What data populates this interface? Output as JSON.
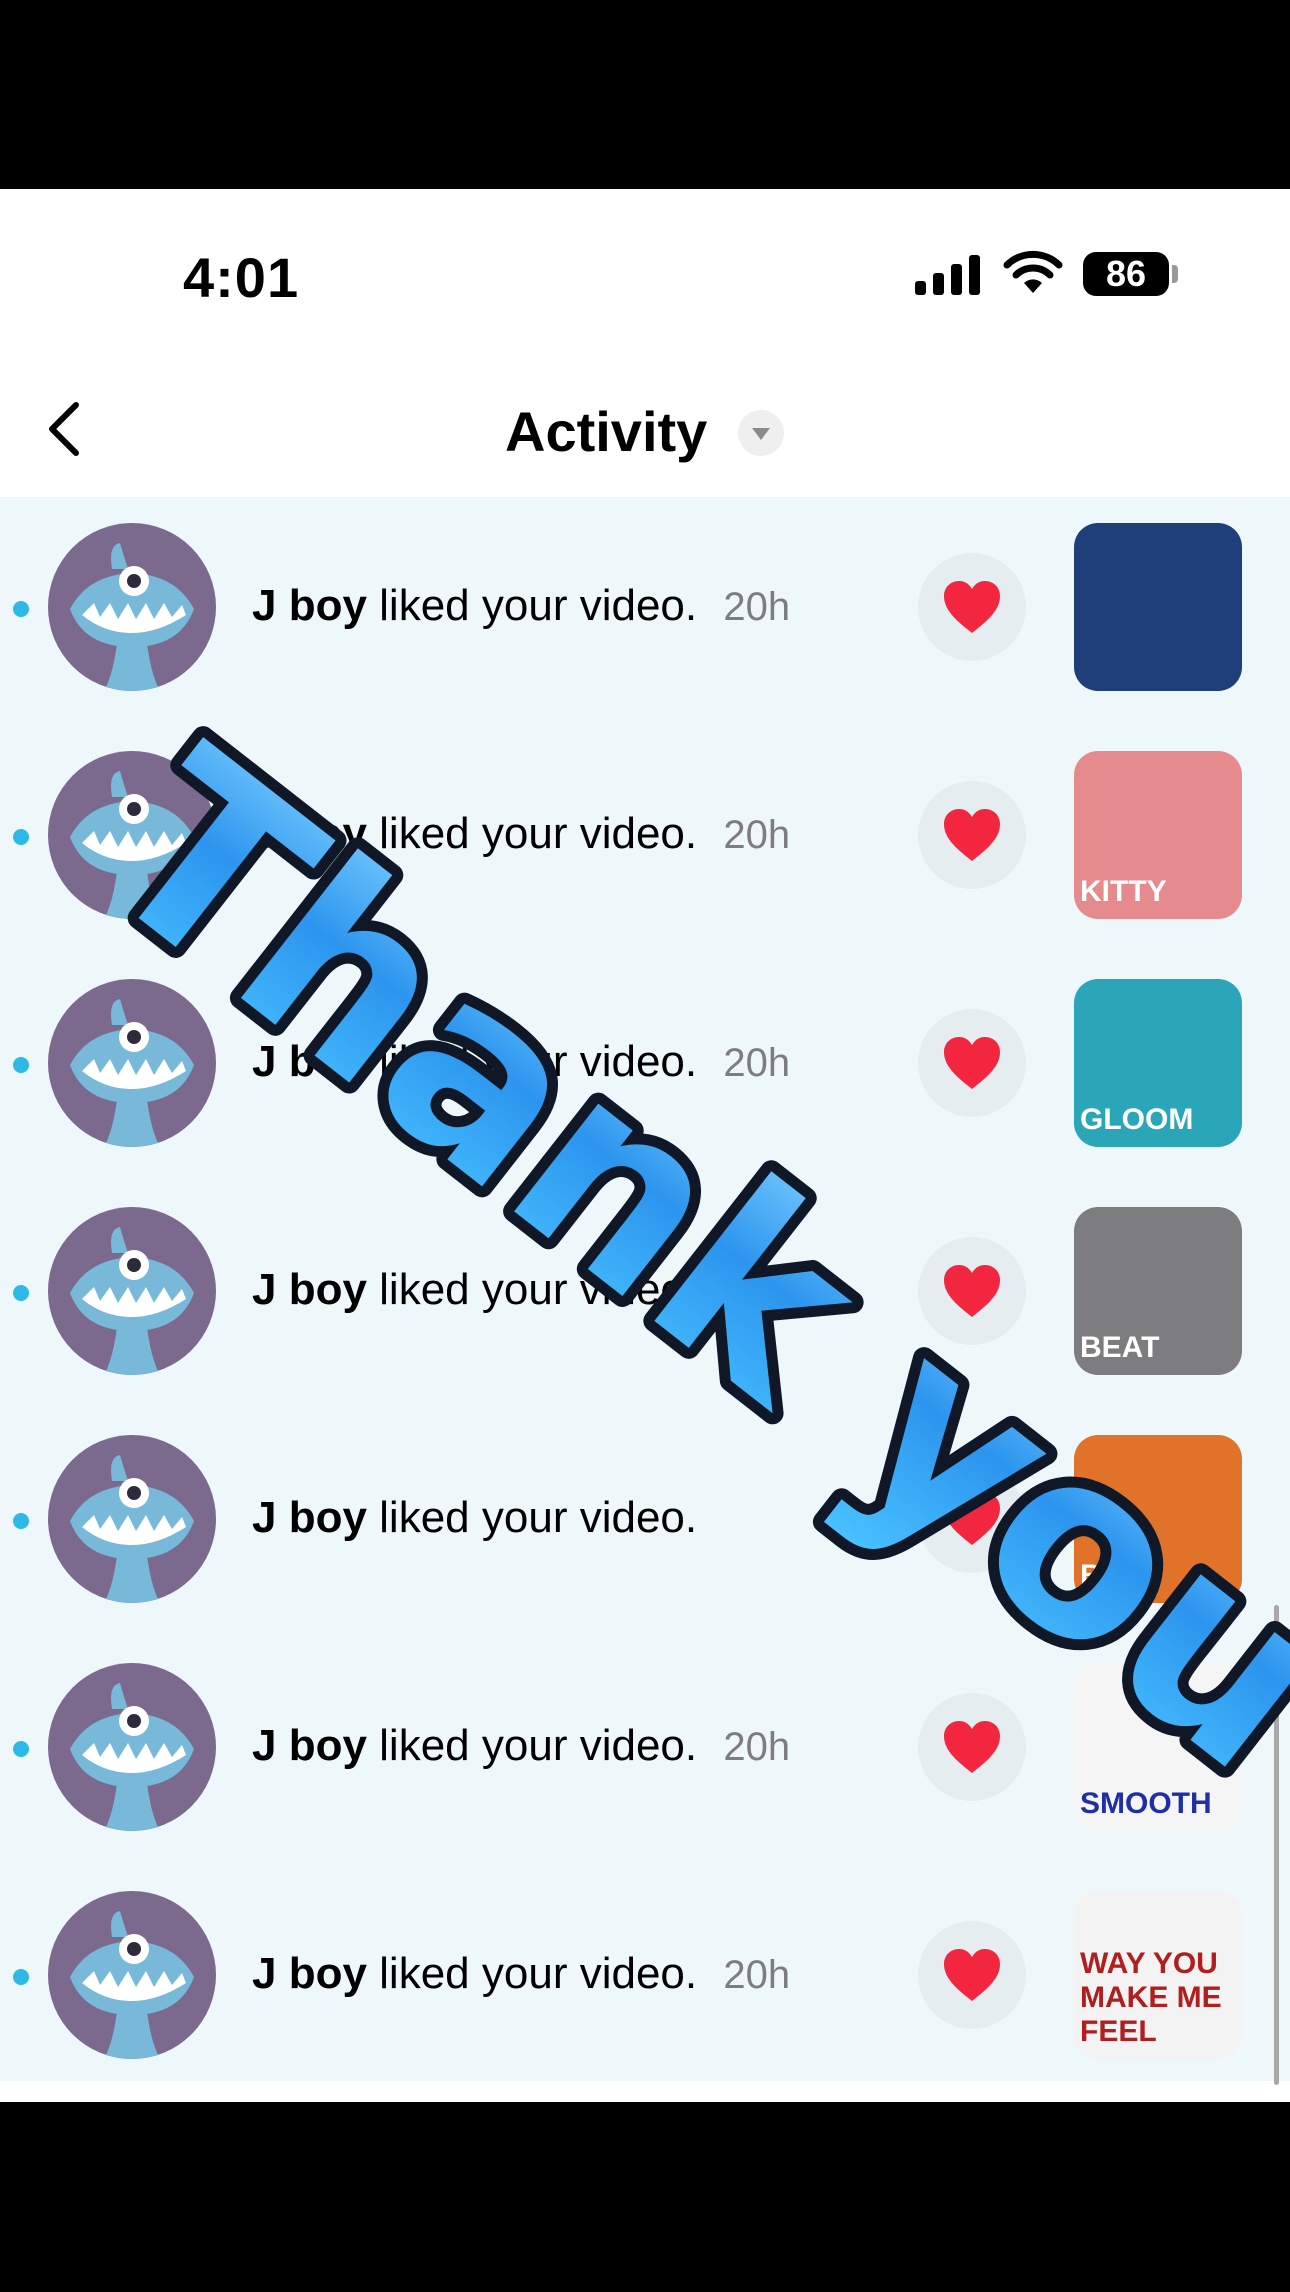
{
  "status_bar": {
    "time": "4:01",
    "battery": "86"
  },
  "header": {
    "title": "Activity"
  },
  "rows": [
    {
      "name": "J boy",
      "action": "liked your video.",
      "time": "20h",
      "thumb_bg": "#1f3f7a",
      "thumb_caption": ""
    },
    {
      "name": "J boy",
      "action": "liked your video.",
      "time": "20h",
      "thumb_bg": "#e58a8d",
      "thumb_caption": "KITTY"
    },
    {
      "name": "J boy",
      "action": "liked your video.",
      "time": "20h",
      "thumb_bg": "#2aa6b8",
      "thumb_caption": "GLOOM"
    },
    {
      "name": "J boy",
      "action": "liked your video.",
      "time": "20h",
      "thumb_bg": "#7d7d80",
      "thumb_caption": "BEAT"
    },
    {
      "name": "J boy",
      "action": "liked your video.",
      "time": "",
      "thumb_bg": "#e0722a",
      "thumb_caption": "Billie"
    },
    {
      "name": "J boy",
      "action": "liked your video.",
      "time": "20h",
      "thumb_bg": "#f5f5f5",
      "thumb_caption": "SMOOTH"
    },
    {
      "name": "J boy",
      "action": "liked your video.",
      "time": "20h",
      "thumb_bg": "#f3f3f3",
      "thumb_caption": "WAY YOU MAKE ME FEEL"
    }
  ],
  "overlay": {
    "text": "Thank you"
  },
  "colors": {
    "unread_dot": "#2db9e6",
    "heart": "#f2263f",
    "avatar_bg": "#7b6a8e",
    "overlay_blue": "#2d9bf0"
  }
}
